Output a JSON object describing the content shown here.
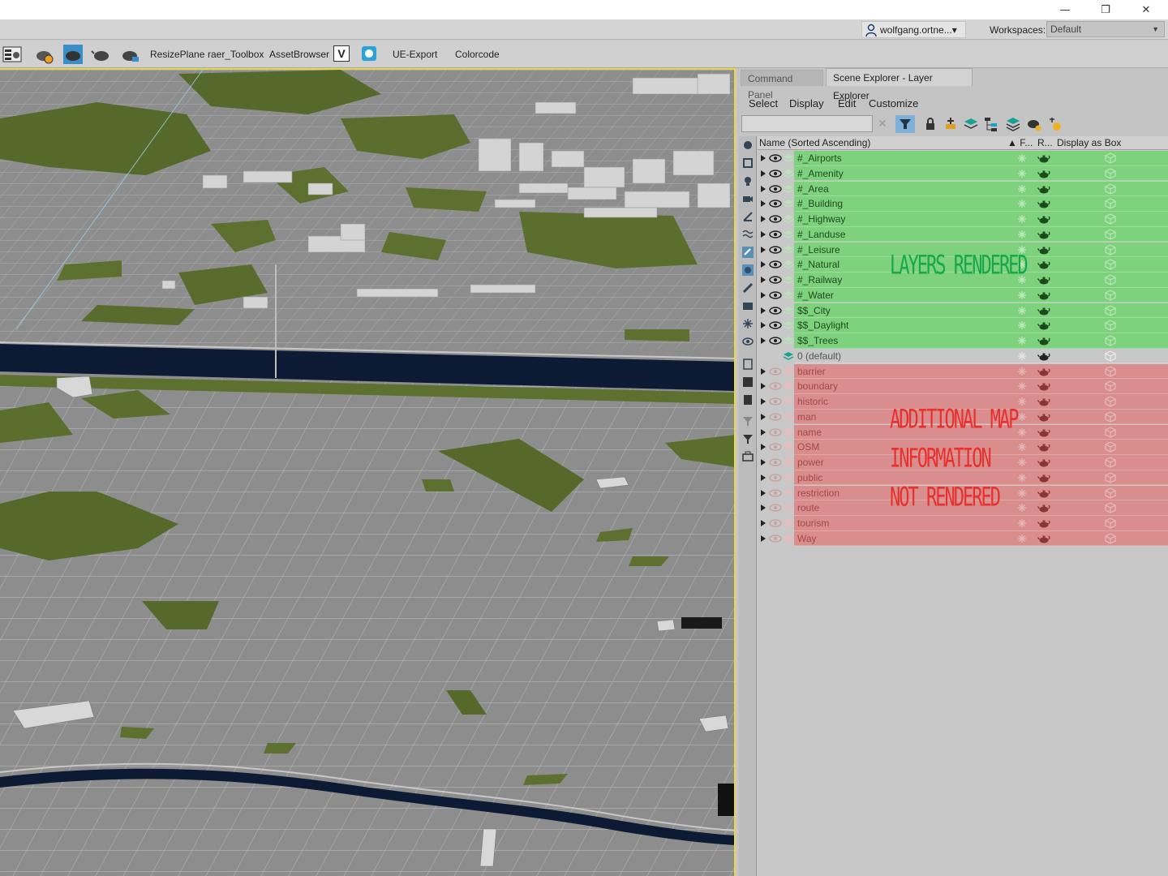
{
  "window": {
    "minimize_glyph": "—",
    "restore_glyph": "❐",
    "close_glyph": "✕"
  },
  "userbar": {
    "user": "wolfgang.ortne...▾",
    "workspaces_label": "Workspaces:",
    "workspace_value": "Default"
  },
  "toolbar": {
    "resize_plane": "ResizePlane",
    "raer_toolbox": "raer_Toolbox",
    "asset_browser": "AssetBrowser",
    "ue_export": "UE-Export",
    "colorcode": "Colorcode",
    "v_glyph": "V"
  },
  "panel": {
    "tab_command": "Command Panel",
    "tab_scene": "Scene Explorer - Layer Explorer",
    "menu": [
      "Select",
      "Display",
      "Edit",
      "Customize"
    ],
    "search_clear": "✕",
    "columns": {
      "name": "Name (Sorted Ascending)",
      "frozen": "▲ F...",
      "render": "R...",
      "display_box": "Display as Box"
    }
  },
  "layers": [
    {
      "name": "#_Airports",
      "state": "rendered"
    },
    {
      "name": "#_Amenity",
      "state": "rendered"
    },
    {
      "name": "#_Area",
      "state": "rendered"
    },
    {
      "name": "#_Building",
      "state": "rendered"
    },
    {
      "name": "#_Highway",
      "state": "rendered"
    },
    {
      "name": "#_Landuse",
      "state": "rendered"
    },
    {
      "name": "#_Leisure",
      "state": "rendered"
    },
    {
      "name": "#_Natural",
      "state": "rendered"
    },
    {
      "name": "#_Railway",
      "state": "rendered"
    },
    {
      "name": "#_Water",
      "state": "rendered"
    },
    {
      "name": "$$_City",
      "state": "rendered"
    },
    {
      "name": "$$_Daylight",
      "state": "rendered"
    },
    {
      "name": "$$_Trees",
      "state": "rendered"
    },
    {
      "name": "0 (default)",
      "state": "default"
    },
    {
      "name": "barrier",
      "state": "hidden"
    },
    {
      "name": "boundary",
      "state": "hidden"
    },
    {
      "name": "historic",
      "state": "hidden"
    },
    {
      "name": "man",
      "state": "hidden"
    },
    {
      "name": "name",
      "state": "hidden"
    },
    {
      "name": "OSM",
      "state": "hidden"
    },
    {
      "name": "power",
      "state": "hidden"
    },
    {
      "name": "public",
      "state": "hidden"
    },
    {
      "name": "restriction",
      "state": "hidden"
    },
    {
      "name": "route",
      "state": "hidden"
    },
    {
      "name": "tourism",
      "state": "hidden"
    },
    {
      "name": "Way",
      "state": "hidden"
    }
  ],
  "annotations": {
    "rendered": "LAYERS RENDERED",
    "not_rendered_1": "ADDITIONAL MAP",
    "not_rendered_2": "INFORMATION",
    "not_rendered_3": "NOT RENDERED"
  },
  "colors": {
    "rendered_highlight": "#7ed27e",
    "not_rendered_highlight": "#d98d8d",
    "annotation_green": "#16a84a",
    "annotation_red": "#e8302e",
    "water": "#0c1a33",
    "park": "#5b6e2e"
  }
}
